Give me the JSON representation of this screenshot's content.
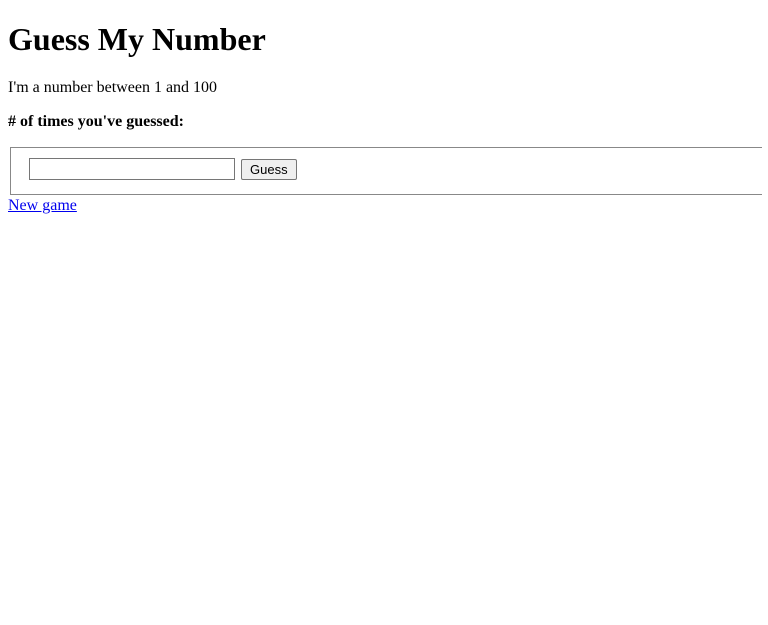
{
  "heading": "Guess My Number",
  "intro": "I'm a number between 1 and 100",
  "guess_count_label": "# of times you've guessed:",
  "form": {
    "guess_value": "",
    "guess_button": "Guess"
  },
  "new_game_link": "New game"
}
